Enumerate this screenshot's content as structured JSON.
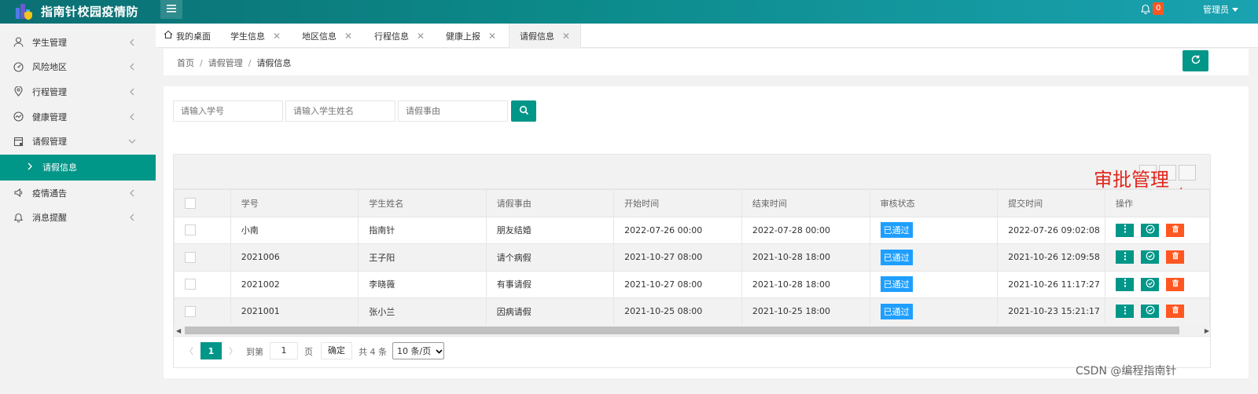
{
  "app": {
    "title": "指南针校园疫情防"
  },
  "header": {
    "notification_count": "0",
    "user": "管理员"
  },
  "sidebar": {
    "items": [
      {
        "label": "学生管理",
        "icon": "user-icon"
      },
      {
        "label": "风险地区",
        "icon": "risk-icon"
      },
      {
        "label": "行程管理",
        "icon": "location-icon"
      },
      {
        "label": "健康管理",
        "icon": "health-icon"
      },
      {
        "label": "请假管理",
        "icon": "leave-icon",
        "expanded": true
      },
      {
        "label": "疫情通告",
        "icon": "announce-icon"
      },
      {
        "label": "消息提醒",
        "icon": "bell-icon"
      }
    ],
    "sub_item": "请假信息"
  },
  "tabs": [
    {
      "label": "我的桌面"
    },
    {
      "label": "学生信息"
    },
    {
      "label": "地区信息"
    },
    {
      "label": "行程信息"
    },
    {
      "label": "健康上报"
    },
    {
      "label": "请假信息",
      "active": true
    }
  ],
  "breadcrumb": {
    "home": "首页",
    "section": "请假管理",
    "current": "请假信息"
  },
  "search": {
    "student_no_placeholder": "请输入学号",
    "student_name_placeholder": "请输入学生姓名",
    "reason_placeholder": "请假事由"
  },
  "annotation": "审批管理",
  "table": {
    "columns": [
      "学号",
      "学生姓名",
      "请假事由",
      "开始时间",
      "结束时间",
      "审核状态",
      "提交时间",
      "操作"
    ],
    "rows": [
      {
        "student_no": "小南",
        "name": "指南针",
        "reason": "朋友结婚",
        "start": "2022-07-26 00:00",
        "end": "2022-07-28 00:00",
        "status": "已通过",
        "submitted": "2022-07-26 09:02:08"
      },
      {
        "student_no": "2021006",
        "name": "王子阳",
        "reason": "请个病假",
        "start": "2021-10-27 08:00",
        "end": "2021-10-28 18:00",
        "status": "已通过",
        "submitted": "2021-10-26 12:09:58"
      },
      {
        "student_no": "2021002",
        "name": "李晓薇",
        "reason": "有事请假",
        "start": "2021-10-27 08:00",
        "end": "2021-10-28 18:00",
        "status": "已通过",
        "submitted": "2021-10-26 11:17:27"
      },
      {
        "student_no": "2021001",
        "name": "张小兰",
        "reason": "因病请假",
        "start": "2021-10-25 08:00",
        "end": "2021-10-25 18:00",
        "status": "已通过",
        "submitted": "2021-10-23 15:21:17"
      }
    ]
  },
  "pager": {
    "current": "1",
    "goto_label": "到第",
    "goto_value": "1",
    "page_label": "页",
    "confirm_label": "确定",
    "total_label": "共 4 条",
    "page_size": "10 条/页"
  },
  "watermark": "CSDN @编程指南针",
  "colors": {
    "primary": "#009688",
    "danger": "#ff5722",
    "status": "#1e9fff",
    "annotation": "#e0261b"
  }
}
